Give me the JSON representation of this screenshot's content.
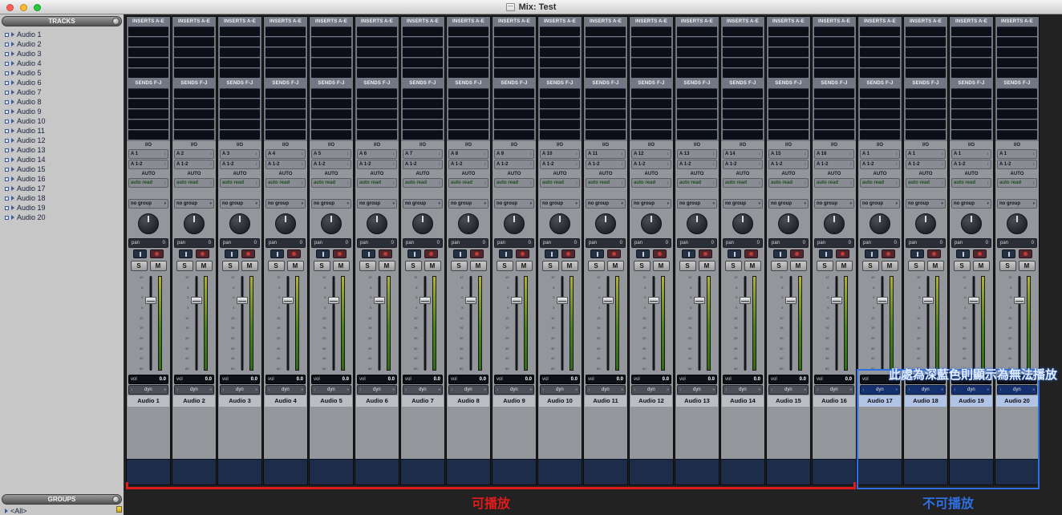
{
  "window": {
    "title": "Mix: Test"
  },
  "sidebar": {
    "tracks_header": "TRACKS",
    "groups_header": "GROUPS",
    "groups_item": "<All>",
    "tracks": [
      "Audio 1",
      "Audio 2",
      "Audio 3",
      "Audio 4",
      "Audio 5",
      "Audio 6",
      "Audio 7",
      "Audio 8",
      "Audio 9",
      "Audio 10",
      "Audio 11",
      "Audio 12",
      "Audio 13",
      "Audio 14",
      "Audio 15",
      "Audio 16",
      "Audio 17",
      "Audio 18",
      "Audio 19",
      "Audio 20"
    ]
  },
  "strip": {
    "inserts_label": "INSERTS A-E",
    "sends_label": "SENDS F-J",
    "io_label": "I/O",
    "output": "A 1-2",
    "auto_label": "AUTO",
    "auto_mode": "auto read",
    "group": "no group",
    "pan_label": "pan",
    "pan_value": "0",
    "solo": "S",
    "mute": "M",
    "vol_label": "vol",
    "vol_value": "0.0",
    "dyn_label": "dyn",
    "fader_scale": [
      "12",
      "6",
      "0",
      "5",
      "10",
      "15",
      "20",
      "30",
      "40",
      "60"
    ]
  },
  "channels": [
    {
      "name": "Audio 1",
      "input": "A 1",
      "playable": true
    },
    {
      "name": "Audio 2",
      "input": "A 2",
      "playable": true
    },
    {
      "name": "Audio 3",
      "input": "A 3",
      "playable": true
    },
    {
      "name": "Audio 4",
      "input": "A 4",
      "playable": true
    },
    {
      "name": "Audio 5",
      "input": "A 5",
      "playable": true
    },
    {
      "name": "Audio 6",
      "input": "A 6",
      "playable": true
    },
    {
      "name": "Audio 7",
      "input": "A 7",
      "playable": true
    },
    {
      "name": "Audio 8",
      "input": "A 8",
      "playable": true
    },
    {
      "name": "Audio 9",
      "input": "A 9",
      "playable": true
    },
    {
      "name": "Audio 10",
      "input": "A 10",
      "playable": true
    },
    {
      "name": "Audio 11",
      "input": "A 11",
      "playable": true
    },
    {
      "name": "Audio 12",
      "input": "A 12",
      "playable": true
    },
    {
      "name": "Audio 13",
      "input": "A 13",
      "playable": true
    },
    {
      "name": "Audio 14",
      "input": "A 14",
      "playable": true
    },
    {
      "name": "Audio 15",
      "input": "A 15",
      "playable": true
    },
    {
      "name": "Audio 16",
      "input": "A 16",
      "playable": true
    },
    {
      "name": "Audio 17",
      "input": "A 1",
      "playable": false
    },
    {
      "name": "Audio 18",
      "input": "A 1",
      "playable": false
    },
    {
      "name": "Audio 19",
      "input": "A 1",
      "playable": false
    },
    {
      "name": "Audio 20",
      "input": "A 1",
      "playable": false
    }
  ],
  "annotations": {
    "note_unplayable": "此處為深藍色則顯示為無法播放",
    "playable_label": "可播放",
    "unplayable_label": "不可播放"
  },
  "colors": {
    "playable_accent": "#e01b1b",
    "unplayable_accent": "#2f6fe0",
    "unplayable_dyn_bg": "#14306e",
    "meter_green": "#478617",
    "meter_yellow": "#b2b233"
  }
}
